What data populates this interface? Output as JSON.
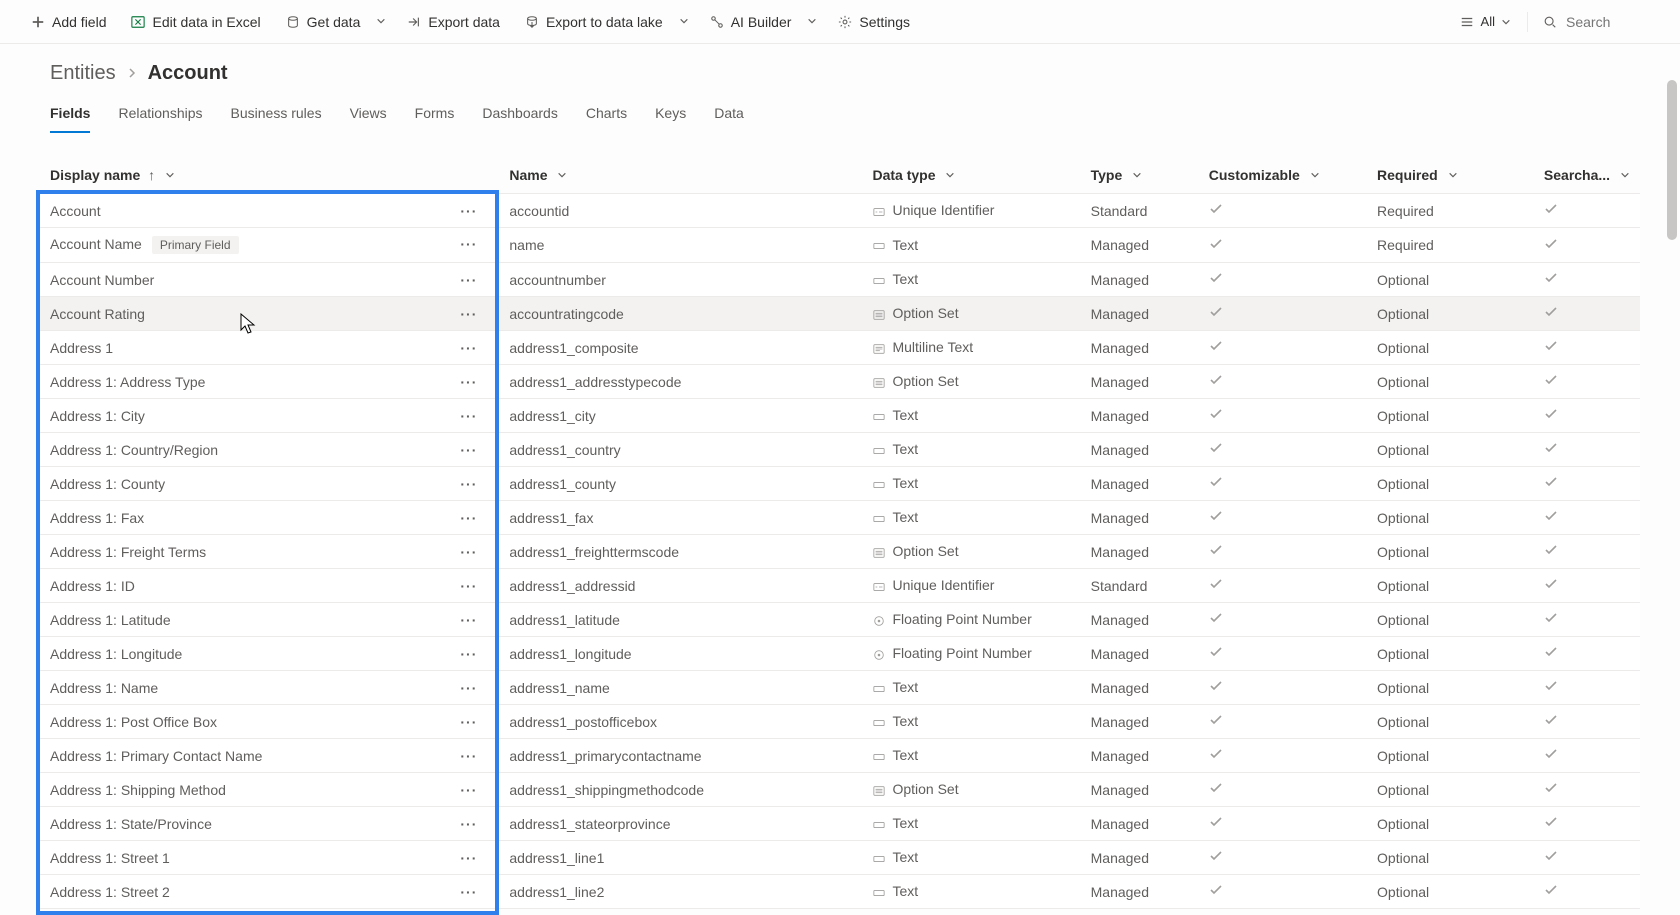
{
  "toolbar": {
    "addField": "Add field",
    "editExcel": "Edit data in Excel",
    "getData": "Get data",
    "exportData": "Export data",
    "exportLake": "Export to data lake",
    "aiBuilder": "AI Builder",
    "settings": "Settings",
    "viewLabel": "All",
    "searchPlaceholder": "Search"
  },
  "breadcrumb": {
    "root": "Entities",
    "current": "Account"
  },
  "tabs": [
    "Fields",
    "Relationships",
    "Business rules",
    "Views",
    "Forms",
    "Dashboards",
    "Charts",
    "Keys",
    "Data"
  ],
  "activeTab": 0,
  "columns": {
    "displayName": "Display name",
    "name": "Name",
    "dataType": "Data type",
    "type": "Type",
    "customizable": "Customizable",
    "required": "Required",
    "searchable": "Searcha..."
  },
  "badges": {
    "primaryField": "Primary Field"
  },
  "rows": [
    {
      "display": "Account",
      "name": "accountid",
      "dtype": "Unique Identifier",
      "dicon": "uid",
      "type": "Standard",
      "cust": true,
      "req": "Required",
      "search": true
    },
    {
      "display": "Account Name",
      "primary": true,
      "name": "name",
      "dtype": "Text",
      "dicon": "text",
      "type": "Managed",
      "cust": true,
      "req": "Required",
      "search": true
    },
    {
      "display": "Account Number",
      "name": "accountnumber",
      "dtype": "Text",
      "dicon": "text",
      "type": "Managed",
      "cust": true,
      "req": "Optional",
      "search": true
    },
    {
      "display": "Account Rating",
      "name": "accountratingcode",
      "dtype": "Option Set",
      "dicon": "opt",
      "type": "Managed",
      "cust": true,
      "req": "Optional",
      "search": true,
      "hovered": true
    },
    {
      "display": "Address 1",
      "name": "address1_composite",
      "dtype": "Multiline Text",
      "dicon": "mtext",
      "type": "Managed",
      "cust": true,
      "req": "Optional",
      "search": true
    },
    {
      "display": "Address 1: Address Type",
      "name": "address1_addresstypecode",
      "dtype": "Option Set",
      "dicon": "opt",
      "type": "Managed",
      "cust": true,
      "req": "Optional",
      "search": true
    },
    {
      "display": "Address 1: City",
      "name": "address1_city",
      "dtype": "Text",
      "dicon": "text",
      "type": "Managed",
      "cust": true,
      "req": "Optional",
      "search": true
    },
    {
      "display": "Address 1: Country/Region",
      "name": "address1_country",
      "dtype": "Text",
      "dicon": "text",
      "type": "Managed",
      "cust": true,
      "req": "Optional",
      "search": true
    },
    {
      "display": "Address 1: County",
      "name": "address1_county",
      "dtype": "Text",
      "dicon": "text",
      "type": "Managed",
      "cust": true,
      "req": "Optional",
      "search": true
    },
    {
      "display": "Address 1: Fax",
      "name": "address1_fax",
      "dtype": "Text",
      "dicon": "text",
      "type": "Managed",
      "cust": true,
      "req": "Optional",
      "search": true
    },
    {
      "display": "Address 1: Freight Terms",
      "name": "address1_freighttermscode",
      "dtype": "Option Set",
      "dicon": "opt",
      "type": "Managed",
      "cust": true,
      "req": "Optional",
      "search": true
    },
    {
      "display": "Address 1: ID",
      "name": "address1_addressid",
      "dtype": "Unique Identifier",
      "dicon": "uid",
      "type": "Standard",
      "cust": true,
      "req": "Optional",
      "search": true
    },
    {
      "display": "Address 1: Latitude",
      "name": "address1_latitude",
      "dtype": "Floating Point Number",
      "dicon": "float",
      "type": "Managed",
      "cust": true,
      "req": "Optional",
      "search": true
    },
    {
      "display": "Address 1: Longitude",
      "name": "address1_longitude",
      "dtype": "Floating Point Number",
      "dicon": "float",
      "type": "Managed",
      "cust": true,
      "req": "Optional",
      "search": true
    },
    {
      "display": "Address 1: Name",
      "name": "address1_name",
      "dtype": "Text",
      "dicon": "text",
      "type": "Managed",
      "cust": true,
      "req": "Optional",
      "search": true
    },
    {
      "display": "Address 1: Post Office Box",
      "name": "address1_postofficebox",
      "dtype": "Text",
      "dicon": "text",
      "type": "Managed",
      "cust": true,
      "req": "Optional",
      "search": true
    },
    {
      "display": "Address 1: Primary Contact Name",
      "name": "address1_primarycontactname",
      "dtype": "Text",
      "dicon": "text",
      "type": "Managed",
      "cust": true,
      "req": "Optional",
      "search": true
    },
    {
      "display": "Address 1: Shipping Method",
      "name": "address1_shippingmethodcode",
      "dtype": "Option Set",
      "dicon": "opt",
      "type": "Managed",
      "cust": true,
      "req": "Optional",
      "search": true
    },
    {
      "display": "Address 1: State/Province",
      "name": "address1_stateorprovince",
      "dtype": "Text",
      "dicon": "text",
      "type": "Managed",
      "cust": true,
      "req": "Optional",
      "search": true
    },
    {
      "display": "Address 1: Street 1",
      "name": "address1_line1",
      "dtype": "Text",
      "dicon": "text",
      "type": "Managed",
      "cust": true,
      "req": "Optional",
      "search": true
    },
    {
      "display": "Address 1: Street 2",
      "name": "address1_line2",
      "dtype": "Text",
      "dicon": "text",
      "type": "Managed",
      "cust": true,
      "req": "Optional",
      "search": true
    }
  ]
}
